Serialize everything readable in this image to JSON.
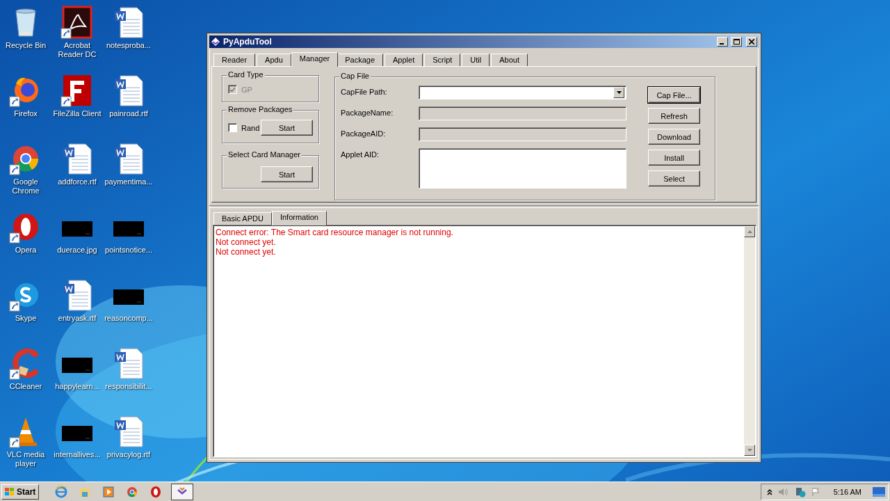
{
  "desktop": {
    "icons": [
      {
        "label": "Recycle Bin",
        "kind": "recycle",
        "shortcut": false
      },
      {
        "label": "Firefox",
        "kind": "firefox",
        "shortcut": true
      },
      {
        "label": "Google Chrome",
        "kind": "chrome",
        "shortcut": true
      },
      {
        "label": "Opera",
        "kind": "opera",
        "shortcut": true
      },
      {
        "label": "Skype",
        "kind": "skype",
        "shortcut": true
      },
      {
        "label": "CCleaner",
        "kind": "ccleaner",
        "shortcut": true
      },
      {
        "label": "VLC media player",
        "kind": "vlc",
        "shortcut": true
      },
      {
        "label": "Acrobat Reader DC",
        "kind": "acrobat",
        "shortcut": true
      },
      {
        "label": "FileZilla Client",
        "kind": "filezilla",
        "shortcut": true
      },
      {
        "label": "addforce.rtf",
        "kind": "word",
        "shortcut": false
      },
      {
        "label": "duerace.jpg",
        "shortcut": false
      },
      {
        "label": "entryask.rtf",
        "kind": "word",
        "shortcut": false
      },
      {
        "label": "happylearn...",
        "shortcut": false
      },
      {
        "label": "internallives...",
        "shortcut": false
      },
      {
        "label": "notesproba...",
        "kind": "word",
        "shortcut": false
      },
      {
        "label": "painroad.rtf",
        "kind": "word",
        "shortcut": false
      },
      {
        "label": "paymentima...",
        "kind": "word",
        "shortcut": false
      },
      {
        "label": "pointsnotice...",
        "shortcut": false
      },
      {
        "label": "reasoncomp...",
        "shortcut": false
      },
      {
        "label": "responsibilit...",
        "kind": "word",
        "shortcut": false
      },
      {
        "label": "privacylog.rtf",
        "kind": "word",
        "shortcut": false
      }
    ]
  },
  "window": {
    "title": "PyApduTool",
    "tabs": [
      {
        "label": "Reader",
        "selected": false
      },
      {
        "label": "Apdu",
        "selected": false
      },
      {
        "label": "Manager",
        "selected": true
      },
      {
        "label": "Package",
        "selected": false
      },
      {
        "label": "Applet",
        "selected": false
      },
      {
        "label": "Script",
        "selected": false
      },
      {
        "label": "Util",
        "selected": false
      },
      {
        "label": "About",
        "selected": false
      }
    ],
    "card_type": {
      "title": "Card Type",
      "checkbox": {
        "label": "GP",
        "checked": true,
        "disabled": true
      }
    },
    "remove_packages": {
      "title": "Remove Packages",
      "checkbox": {
        "label": "Rand",
        "checked": false,
        "disabled": false
      },
      "button": "Start"
    },
    "select_card_manager": {
      "title": "Select Card Manager",
      "button": "Start"
    },
    "cap_file": {
      "title": "Cap File",
      "fields": [
        {
          "label": "CapFile Path:",
          "kind": "combo"
        },
        {
          "label": "PackageName:",
          "kind": "readonly"
        },
        {
          "label": "PackageAID:",
          "kind": "readonly"
        },
        {
          "label": "Applet AID:",
          "kind": "textarea"
        }
      ],
      "buttons": [
        {
          "label": "Cap File...",
          "default": true
        },
        {
          "label": "Refresh",
          "default": false
        },
        {
          "label": "Download",
          "default": false
        },
        {
          "label": "Install",
          "default": false
        },
        {
          "label": "Select",
          "default": false
        }
      ]
    },
    "log_tabs": [
      {
        "label": "Basic APDU",
        "selected": false
      },
      {
        "label": "Information",
        "selected": true
      }
    ],
    "log": {
      "lines": [
        "Connect error: The Smart card resource manager is not running.",
        "Not connect yet.",
        "Not connect yet."
      ]
    }
  },
  "taskbar": {
    "start": "Start",
    "apps": [
      {
        "kind": "ie",
        "active": false
      },
      {
        "kind": "explorer",
        "active": false
      },
      {
        "kind": "media",
        "active": false
      },
      {
        "kind": "chrome",
        "active": false
      },
      {
        "kind": "opera",
        "active": false
      },
      {
        "kind": "pyapdu",
        "active": true
      }
    ],
    "clock": "5:16 AM"
  }
}
